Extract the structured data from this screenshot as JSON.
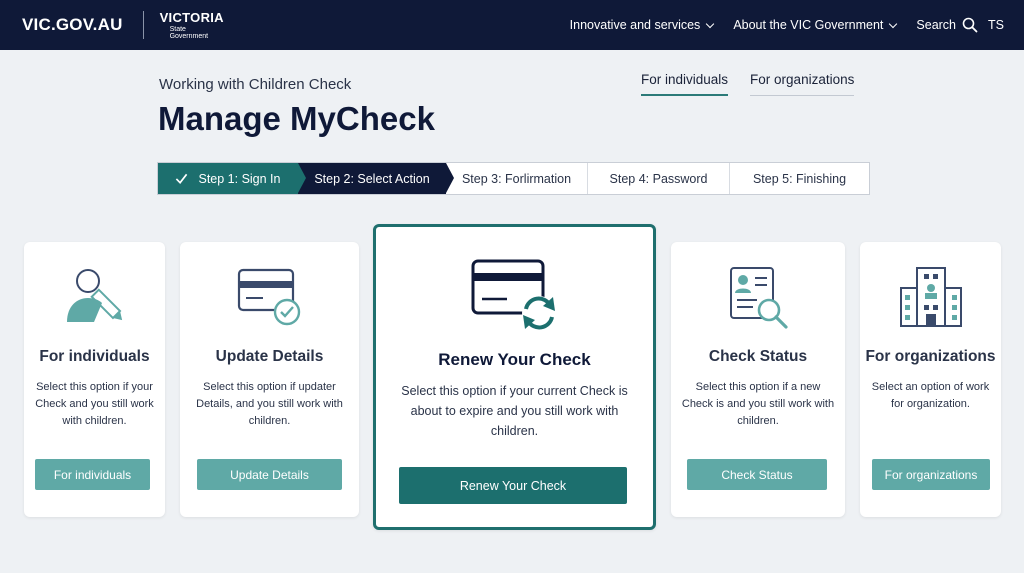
{
  "header": {
    "logo": "VIC.GOV.AU",
    "gov_title": "VICTORIA",
    "gov_sub1": "State",
    "gov_sub2": "Government",
    "nav": {
      "item1": "Innovative and services",
      "item2": "About the VIC Government",
      "search": "Search",
      "initials": "TS"
    }
  },
  "intro": {
    "eyebrow": "Working with Children Check",
    "title": "Manage MyCheck"
  },
  "tabs": {
    "individuals": "For individuals",
    "organizations": "For organizations"
  },
  "stepper": {
    "step1": "Step 1: Sign In",
    "step2": "Step 2: Select Action",
    "step3": "Step 3: Forlirmation",
    "step4": "Step 4: Password",
    "step5": "Step 5: Finishing"
  },
  "cards": {
    "individuals": {
      "title": "For individuals",
      "desc": "Select this option if your Check and you still work with children.",
      "button": "For individuals"
    },
    "update": {
      "title": "Update Details",
      "desc": "Select this option if updater Details, and you still work with children.",
      "button": "Update Details"
    },
    "renew": {
      "title": "Renew Your Check",
      "desc": "Select this option if your current Check is about to expire and you still work with children.",
      "button": "Renew Your Check"
    },
    "status": {
      "title": "Check Status",
      "desc": "Select this option if a new Check is and you still work with children.",
      "button": "Check Status"
    },
    "organizations": {
      "title": "For organizations",
      "desc": "Select an option of work for organization.",
      "button": "For organizations"
    }
  },
  "icons": {
    "person": "person-pencil-icon",
    "card": "card-check-icon",
    "renew": "card-refresh-icon",
    "status": "id-search-icon",
    "org": "building-icon",
    "search": "search-icon",
    "check": "check-icon"
  },
  "colors": {
    "navy": "#0f1938",
    "teal": "#1c6f6e",
    "teal_light": "#5fa9a6",
    "background": "#eef1f4"
  }
}
